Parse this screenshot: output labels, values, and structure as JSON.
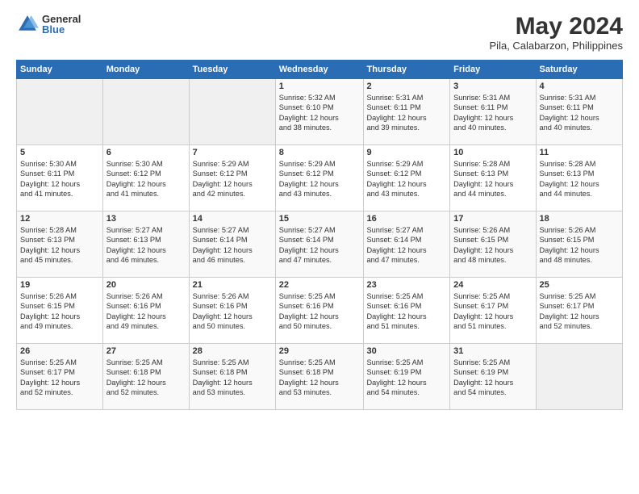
{
  "logo": {
    "general": "General",
    "blue": "Blue"
  },
  "title": {
    "main": "May 2024",
    "subtitle": "Pila, Calabarzon, Philippines"
  },
  "headers": [
    "Sunday",
    "Monday",
    "Tuesday",
    "Wednesday",
    "Thursday",
    "Friday",
    "Saturday"
  ],
  "weeks": [
    [
      {
        "num": "",
        "info": ""
      },
      {
        "num": "",
        "info": ""
      },
      {
        "num": "",
        "info": ""
      },
      {
        "num": "1",
        "info": "Sunrise: 5:32 AM\nSunset: 6:10 PM\nDaylight: 12 hours\nand 38 minutes."
      },
      {
        "num": "2",
        "info": "Sunrise: 5:31 AM\nSunset: 6:11 PM\nDaylight: 12 hours\nand 39 minutes."
      },
      {
        "num": "3",
        "info": "Sunrise: 5:31 AM\nSunset: 6:11 PM\nDaylight: 12 hours\nand 40 minutes."
      },
      {
        "num": "4",
        "info": "Sunrise: 5:31 AM\nSunset: 6:11 PM\nDaylight: 12 hours\nand 40 minutes."
      }
    ],
    [
      {
        "num": "5",
        "info": "Sunrise: 5:30 AM\nSunset: 6:11 PM\nDaylight: 12 hours\nand 41 minutes."
      },
      {
        "num": "6",
        "info": "Sunrise: 5:30 AM\nSunset: 6:12 PM\nDaylight: 12 hours\nand 41 minutes."
      },
      {
        "num": "7",
        "info": "Sunrise: 5:29 AM\nSunset: 6:12 PM\nDaylight: 12 hours\nand 42 minutes."
      },
      {
        "num": "8",
        "info": "Sunrise: 5:29 AM\nSunset: 6:12 PM\nDaylight: 12 hours\nand 43 minutes."
      },
      {
        "num": "9",
        "info": "Sunrise: 5:29 AM\nSunset: 6:12 PM\nDaylight: 12 hours\nand 43 minutes."
      },
      {
        "num": "10",
        "info": "Sunrise: 5:28 AM\nSunset: 6:13 PM\nDaylight: 12 hours\nand 44 minutes."
      },
      {
        "num": "11",
        "info": "Sunrise: 5:28 AM\nSunset: 6:13 PM\nDaylight: 12 hours\nand 44 minutes."
      }
    ],
    [
      {
        "num": "12",
        "info": "Sunrise: 5:28 AM\nSunset: 6:13 PM\nDaylight: 12 hours\nand 45 minutes."
      },
      {
        "num": "13",
        "info": "Sunrise: 5:27 AM\nSunset: 6:13 PM\nDaylight: 12 hours\nand 46 minutes."
      },
      {
        "num": "14",
        "info": "Sunrise: 5:27 AM\nSunset: 6:14 PM\nDaylight: 12 hours\nand 46 minutes."
      },
      {
        "num": "15",
        "info": "Sunrise: 5:27 AM\nSunset: 6:14 PM\nDaylight: 12 hours\nand 47 minutes."
      },
      {
        "num": "16",
        "info": "Sunrise: 5:27 AM\nSunset: 6:14 PM\nDaylight: 12 hours\nand 47 minutes."
      },
      {
        "num": "17",
        "info": "Sunrise: 5:26 AM\nSunset: 6:15 PM\nDaylight: 12 hours\nand 48 minutes."
      },
      {
        "num": "18",
        "info": "Sunrise: 5:26 AM\nSunset: 6:15 PM\nDaylight: 12 hours\nand 48 minutes."
      }
    ],
    [
      {
        "num": "19",
        "info": "Sunrise: 5:26 AM\nSunset: 6:15 PM\nDaylight: 12 hours\nand 49 minutes."
      },
      {
        "num": "20",
        "info": "Sunrise: 5:26 AM\nSunset: 6:16 PM\nDaylight: 12 hours\nand 49 minutes."
      },
      {
        "num": "21",
        "info": "Sunrise: 5:26 AM\nSunset: 6:16 PM\nDaylight: 12 hours\nand 50 minutes."
      },
      {
        "num": "22",
        "info": "Sunrise: 5:25 AM\nSunset: 6:16 PM\nDaylight: 12 hours\nand 50 minutes."
      },
      {
        "num": "23",
        "info": "Sunrise: 5:25 AM\nSunset: 6:16 PM\nDaylight: 12 hours\nand 51 minutes."
      },
      {
        "num": "24",
        "info": "Sunrise: 5:25 AM\nSunset: 6:17 PM\nDaylight: 12 hours\nand 51 minutes."
      },
      {
        "num": "25",
        "info": "Sunrise: 5:25 AM\nSunset: 6:17 PM\nDaylight: 12 hours\nand 52 minutes."
      }
    ],
    [
      {
        "num": "26",
        "info": "Sunrise: 5:25 AM\nSunset: 6:17 PM\nDaylight: 12 hours\nand 52 minutes."
      },
      {
        "num": "27",
        "info": "Sunrise: 5:25 AM\nSunset: 6:18 PM\nDaylight: 12 hours\nand 52 minutes."
      },
      {
        "num": "28",
        "info": "Sunrise: 5:25 AM\nSunset: 6:18 PM\nDaylight: 12 hours\nand 53 minutes."
      },
      {
        "num": "29",
        "info": "Sunrise: 5:25 AM\nSunset: 6:18 PM\nDaylight: 12 hours\nand 53 minutes."
      },
      {
        "num": "30",
        "info": "Sunrise: 5:25 AM\nSunset: 6:19 PM\nDaylight: 12 hours\nand 54 minutes."
      },
      {
        "num": "31",
        "info": "Sunrise: 5:25 AM\nSunset: 6:19 PM\nDaylight: 12 hours\nand 54 minutes."
      },
      {
        "num": "",
        "info": ""
      }
    ]
  ]
}
